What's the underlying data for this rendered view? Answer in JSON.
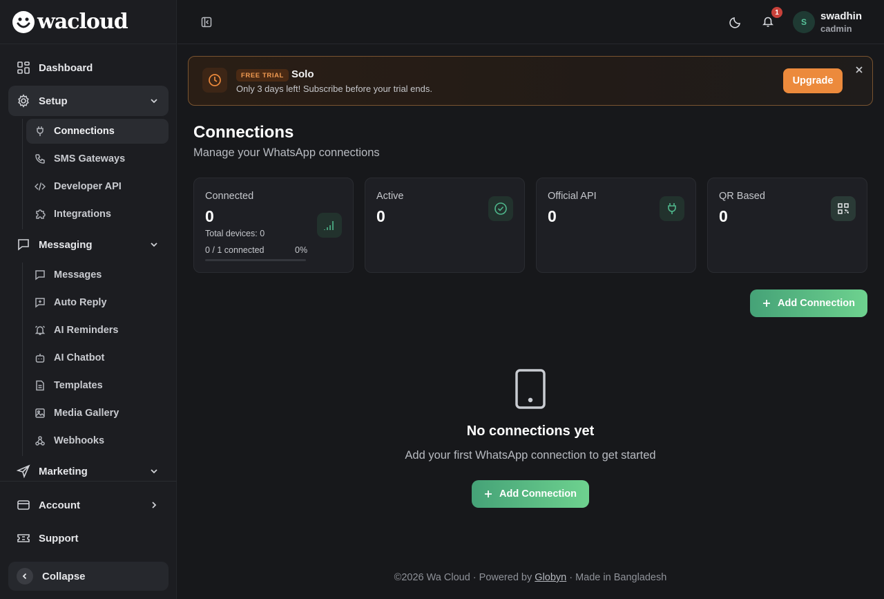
{
  "brand": {
    "name": "wacloud"
  },
  "sidebar": {
    "dashboard": "Dashboard",
    "setup": "Setup",
    "setup_items": [
      "Connections",
      "SMS Gateways",
      "Developer API",
      "Integrations"
    ],
    "messaging": "Messaging",
    "messaging_items": [
      "Messages",
      "Auto Reply",
      "AI Reminders",
      "AI Chatbot",
      "Templates",
      "Media Gallery",
      "Webhooks"
    ],
    "marketing": "Marketing",
    "account": "Account",
    "support": "Support",
    "collapse": "Collapse"
  },
  "topbar": {
    "notification_count": "1",
    "avatar_initial": "S",
    "user_name": "swadhin",
    "user_role": "cadmin"
  },
  "trial": {
    "badge": "FREE TRIAL",
    "plan": "Solo",
    "message": "Only 3 days left! Subscribe before your trial ends.",
    "upgrade": "Upgrade"
  },
  "page": {
    "title": "Connections",
    "subtitle": "Manage your WhatsApp connections"
  },
  "stats": {
    "connected": {
      "label": "Connected",
      "value": "0",
      "total_devices": "Total devices: 0",
      "ratio": "0 / 1 connected",
      "percent": "0%",
      "progress": 0
    },
    "active": {
      "label": "Active",
      "value": "0"
    },
    "official": {
      "label": "Official API",
      "value": "0"
    },
    "qr": {
      "label": "QR Based",
      "value": "0"
    }
  },
  "actions": {
    "add_connection": "Add Connection"
  },
  "empty": {
    "title": "No connections yet",
    "subtitle": "Add your first WhatsApp connection to get started",
    "button": "Add Connection"
  },
  "footer": {
    "prefix": "©2026 Wa Cloud · Powered by ",
    "link": "Globyn",
    "suffix": " · Made in Bangladesh"
  },
  "colors": {
    "accent_green": "#4fb88c",
    "trial_orange": "#ec8a3c",
    "notification_red": "#c8413a"
  },
  "icons": {
    "dashboard": "grid-icon",
    "setup": "gear-icon",
    "connections": "plug-icon",
    "sms": "phone-icon",
    "developer": "code-icon",
    "integrations": "puzzle-icon",
    "messaging": "chat-icon",
    "messages": "message-icon",
    "auto_reply": "reply-icon",
    "ai_reminders": "alarm-icon",
    "ai_chatbot": "bot-icon",
    "templates": "file-icon",
    "media": "image-icon",
    "webhooks": "webhook-icon",
    "marketing": "send-icon",
    "account": "card-icon",
    "support": "ticket-icon"
  }
}
